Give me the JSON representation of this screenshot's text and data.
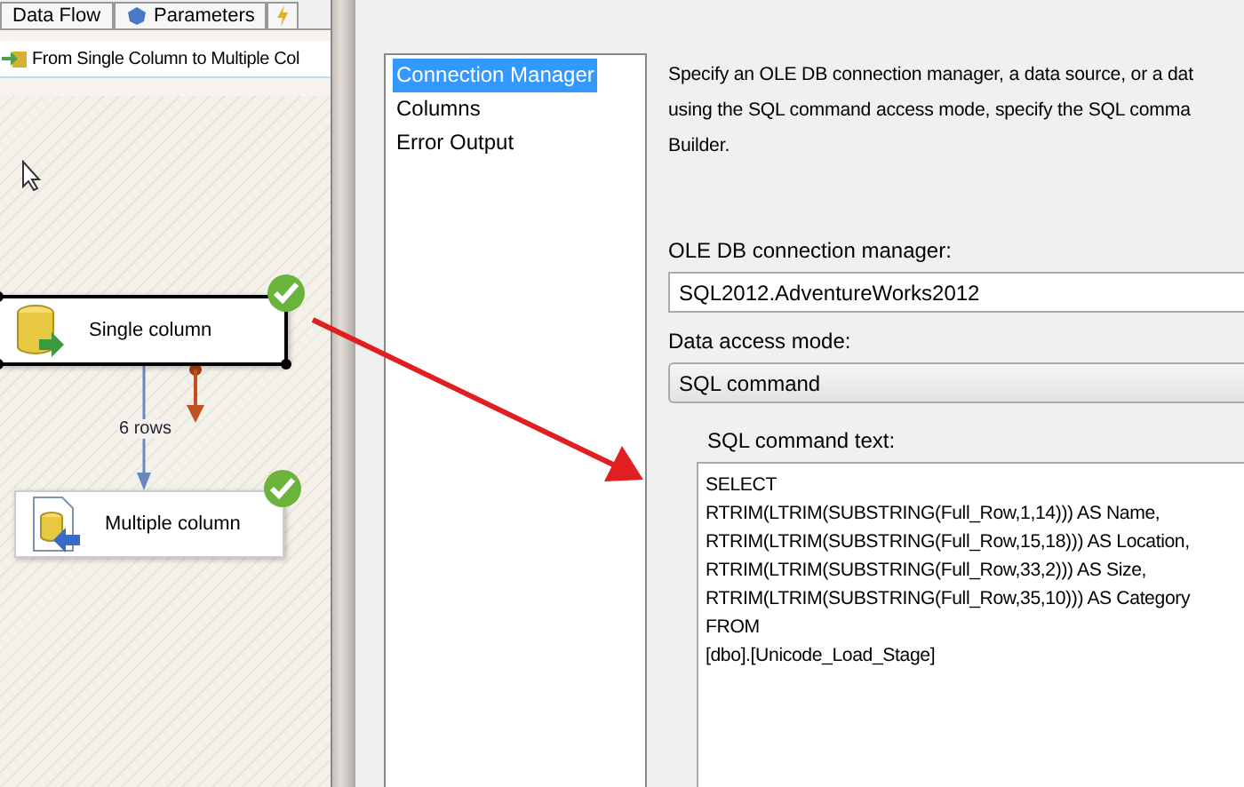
{
  "designer": {
    "tabs": [
      {
        "label": "Data Flow",
        "selected": false
      },
      {
        "label": "Parameters",
        "selected": false
      }
    ],
    "breadcrumb": "From Single Column to Multiple Col",
    "nodes": [
      {
        "label": "Single column",
        "kind": "source",
        "selected": true,
        "valid": true
      },
      {
        "label": "Multiple column",
        "kind": "destination",
        "selected": false,
        "valid": true
      }
    ],
    "path_label": "6 rows"
  },
  "dialog": {
    "pages": [
      {
        "label": "Connection Manager",
        "selected": true
      },
      {
        "label": "Columns",
        "selected": false
      },
      {
        "label": "Error Output",
        "selected": false
      }
    ],
    "description": [
      "Specify an OLE DB connection manager, a data source, or a dat",
      "using the SQL command access mode, specify the SQL comma",
      "Builder."
    ],
    "connection_manager": {
      "label": "OLE DB connection manager:",
      "value": "SQL2012.AdventureWorks2012"
    },
    "access_mode": {
      "label": "Data access mode:",
      "value": "SQL command"
    },
    "sql_command": {
      "label": "SQL command text:",
      "value": "SELECT\nRTRIM(LTRIM(SUBSTRING(Full_Row,1,14))) AS Name,\nRTRIM(LTRIM(SUBSTRING(Full_Row,15,18))) AS Location,\nRTRIM(LTRIM(SUBSTRING(Full_Row,33,2))) AS Size,\nRTRIM(LTRIM(SUBSTRING(Full_Row,35,10))) AS Category\nFROM\n[dbo].[Unicode_Load_Stage]"
    }
  }
}
